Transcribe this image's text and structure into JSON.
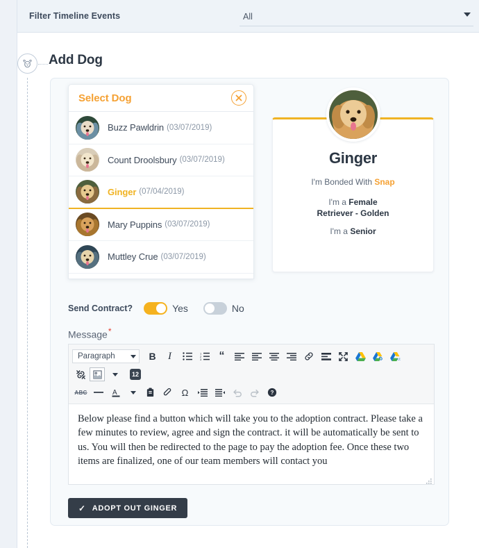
{
  "filter_bar": {
    "label": "Filter Timeline Events",
    "select_value": "All",
    "select_icon": "chevron-down-icon"
  },
  "timeline": {
    "node_icon": "dog-face-icon"
  },
  "page_title": "Add Dog",
  "select_dog_panel": {
    "title": "Select Dog",
    "close_icon": "close-icon",
    "dogs": [
      {
        "name": "Buzz Pawldrin",
        "date": "(03/07/2019)",
        "selected": false
      },
      {
        "name": "Count Droolsbury",
        "date": "(03/07/2019)",
        "selected": false
      },
      {
        "name": "Ginger",
        "date": "(07/04/2019)",
        "selected": true
      },
      {
        "name": "Mary Puppins",
        "date": "(03/07/2019)",
        "selected": false
      },
      {
        "name": "Muttley Crue",
        "date": "(03/07/2019)",
        "selected": false
      }
    ]
  },
  "profile": {
    "name": "Ginger",
    "bonded_prefix": "I'm Bonded With ",
    "bonded_with": "Snap",
    "sex_prefix": "I'm a ",
    "sex": "Female",
    "breed": "Retriever - Golden",
    "age_prefix": "I'm a ",
    "age": "Senior"
  },
  "contract": {
    "label": "Send Contract?",
    "yes_label": "Yes",
    "no_label": "No",
    "yes_on": true,
    "no_on": false
  },
  "message": {
    "label": "Message",
    "required_mark": "*",
    "body": "Below please find a button which will take you to the adoption contract. Please take a few minutes to review, agree and sign the contract. it will be automatically be sent to us. You will then be redirected to the page to pay the adoption fee. Once these two items are finalized, one of our team members will contact you"
  },
  "toolbar": {
    "paragraph_label": "Paragraph",
    "font_size_badge": "12",
    "row1": [
      "bold-icon",
      "italic-icon",
      "bullet-list-icon",
      "numbered-list-icon",
      "blockquote-icon",
      "align-left-icon",
      "align-left-2-icon",
      "align-center-icon",
      "align-right-icon",
      "link-icon",
      "horizontal-rule-icon",
      "fullscreen-icon",
      "google-drive-icon",
      "google-drive-link-icon",
      "google-drive-embed-icon"
    ],
    "row2": [
      "unlink-icon",
      "image-icon",
      "font-size-icon"
    ],
    "row3": [
      "strikethrough-icon",
      "horizontal-line-icon",
      "text-color-icon",
      "paste-icon",
      "clear-format-icon",
      "special-char-icon",
      "indent-icon",
      "outdent-icon",
      "undo-icon",
      "redo-icon",
      "help-icon"
    ]
  },
  "adopt_button": {
    "label": "ADOPT OUT GINGER",
    "check_icon": "check-icon"
  },
  "colors": {
    "accent_orange": "#f5a133",
    "accent_yellow": "#f0b323",
    "dark": "#343d48",
    "bg": "#f7fafc",
    "required_red": "#e43b2c"
  }
}
